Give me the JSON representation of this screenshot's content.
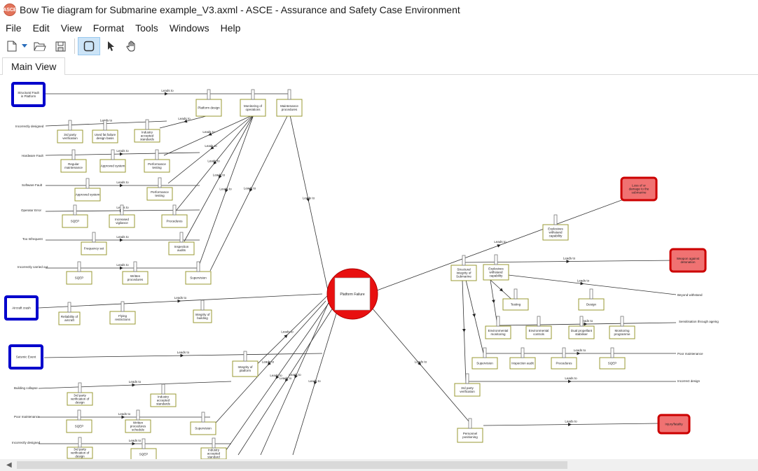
{
  "window": {
    "title": "Bow Tie diagram for Submarine example_V3.axml - ASCE - Assurance and Safety Case Environment",
    "icon": "asce-app-icon"
  },
  "menu": [
    "File",
    "Edit",
    "View",
    "Format",
    "Tools",
    "Windows",
    "Help"
  ],
  "toolbar": {
    "buttons": [
      "new-document-icon",
      "dropdown-arrow-icon",
      "open-folder-icon",
      "save-icon",
      "select-box-icon",
      "pointer-icon",
      "hand-pan-icon"
    ]
  },
  "tabs": [
    "Main View"
  ],
  "colors": {
    "threat_border": "#0000cc",
    "consequence_fill": "#f07272",
    "consequence_border": "#cc0000",
    "top_event_border": "#cc0000",
    "barrier_border": "#999933",
    "link": "#333333"
  },
  "diagram": {
    "edge_label": "Leads to",
    "top_event": "Platform Failure",
    "threats": [
      "Structural Fault in Platform",
      "Aircraft crash",
      "Seismic Event"
    ],
    "consequences": [
      "Loss of or damage to the submarine",
      "Weapon against detonation",
      "Injury/fatality"
    ],
    "causes": [
      "Incorrectly designed",
      "Hardware Fault",
      "Software Fault",
      "Operator Error",
      "Too Infrequent",
      "Incorrectly carried out",
      "Building collapse",
      "Poor maintenance",
      "Incorrectly designed"
    ],
    "right_causes": [
      "Beyond withstand",
      "Sensitisation through ageing",
      "Poor maintenance",
      "Incorrect design"
    ],
    "barriers": {
      "b1": "Platform design",
      "b2": "Monitoring of operations",
      "b3": "Maintenance procedures",
      "b4": "3rd party verification",
      "b5": "Used fat failure design basis",
      "b6": "Industry accepted standards",
      "b7": "Regular maintenance",
      "b8": "Approved system",
      "b9": "Performance testing",
      "b10": "Approved system",
      "b11": "Performance testing",
      "b12": "SQEP",
      "b13": "Increased vigilance",
      "b14": "Procedures",
      "b15": "Frequency set",
      "b16": "Inspection audits",
      "b17": "SQEP",
      "b18": "Written procedures",
      "b19": "Supervision",
      "b20": "Reliability of aircraft",
      "b21": "Flying restrictions",
      "b22": "Integrity of building",
      "b23": "Integrity of platform",
      "b24": "3rd party verification of design",
      "b25": "Industry accepted standards",
      "b26": "SQEP",
      "b27": "Written procedures schedule",
      "b28": "Supervision",
      "b29": "3rd party verification of design",
      "b30": "SQEP",
      "b31": "Industry accepted standard",
      "r1": "Explosives withstand capability",
      "r2": "Structural Integrity of Submarine",
      "r3": "Explosives withstand capability",
      "r4": "Testing",
      "r5": "Design",
      "r6": "Environmental monitoring",
      "r7": "Environmental controls",
      "r8": "Dual propellant stabiliser",
      "r9": "Monitoring programme",
      "r10": "Supervision",
      "r11": "Inspection audit",
      "r12": "Procedures",
      "r13": "SQEP",
      "r14": "3rd party verification",
      "r15": "Personnel positioning"
    }
  }
}
